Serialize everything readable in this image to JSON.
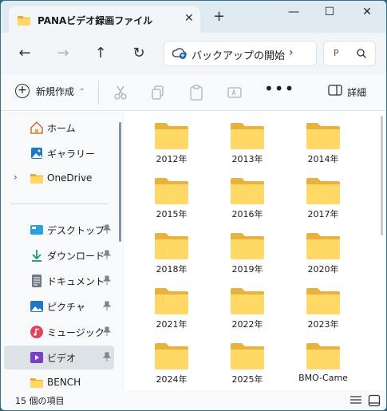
{
  "titlebar": {
    "tab_title": "PANAビデオ録画ファイル",
    "close_tab": "✕",
    "new_tab": "+",
    "minimize": "—",
    "maximize": "☐",
    "close": "✕"
  },
  "nav": {
    "back": "←",
    "forward": "→",
    "up": "↑",
    "refresh": "↻",
    "address_text": "バックアップの開始",
    "address_chevron": "›",
    "search_text": "P"
  },
  "commandbar": {
    "new_label": "新規作成",
    "new_chevron": "⌄",
    "more": "•••",
    "details_label": "詳細"
  },
  "sidebar": {
    "items": [
      {
        "label": "ホーム",
        "icon": "home-icon"
      },
      {
        "label": "ギャラリー",
        "icon": "gallery-icon"
      },
      {
        "label": "OneDrive",
        "icon": "folder-icon",
        "expand": "›"
      },
      {
        "label": "デスクトップ",
        "icon": "desktop-icon",
        "pin": "📌"
      },
      {
        "label": "ダウンロード",
        "icon": "download-icon",
        "pin": "📌"
      },
      {
        "label": "ドキュメント",
        "icon": "document-icon",
        "pin": "📌"
      },
      {
        "label": "ピクチャ",
        "icon": "pictures-icon",
        "pin": "📌"
      },
      {
        "label": "ミュージック",
        "icon": "music-icon",
        "pin": "📌"
      },
      {
        "label": "ビデオ",
        "icon": "video-icon",
        "pin": "📌",
        "selected": true
      },
      {
        "label": "BENCH",
        "icon": "folder-icon"
      }
    ]
  },
  "content": {
    "folders": [
      "2012年",
      "2013年",
      "2014年",
      "2015年",
      "2016年",
      "2017年",
      "2018年",
      "2019年",
      "2020年",
      "2021年",
      "2022年",
      "2023年",
      "2024年",
      "2025年",
      "BMO-Came"
    ]
  },
  "status": {
    "item_count": "15 個の項目"
  },
  "colors": {
    "folder": "#f5c542",
    "folder_front": "#ffd866",
    "accent": "#0067c0",
    "titlebar": "#dfe9f1"
  }
}
